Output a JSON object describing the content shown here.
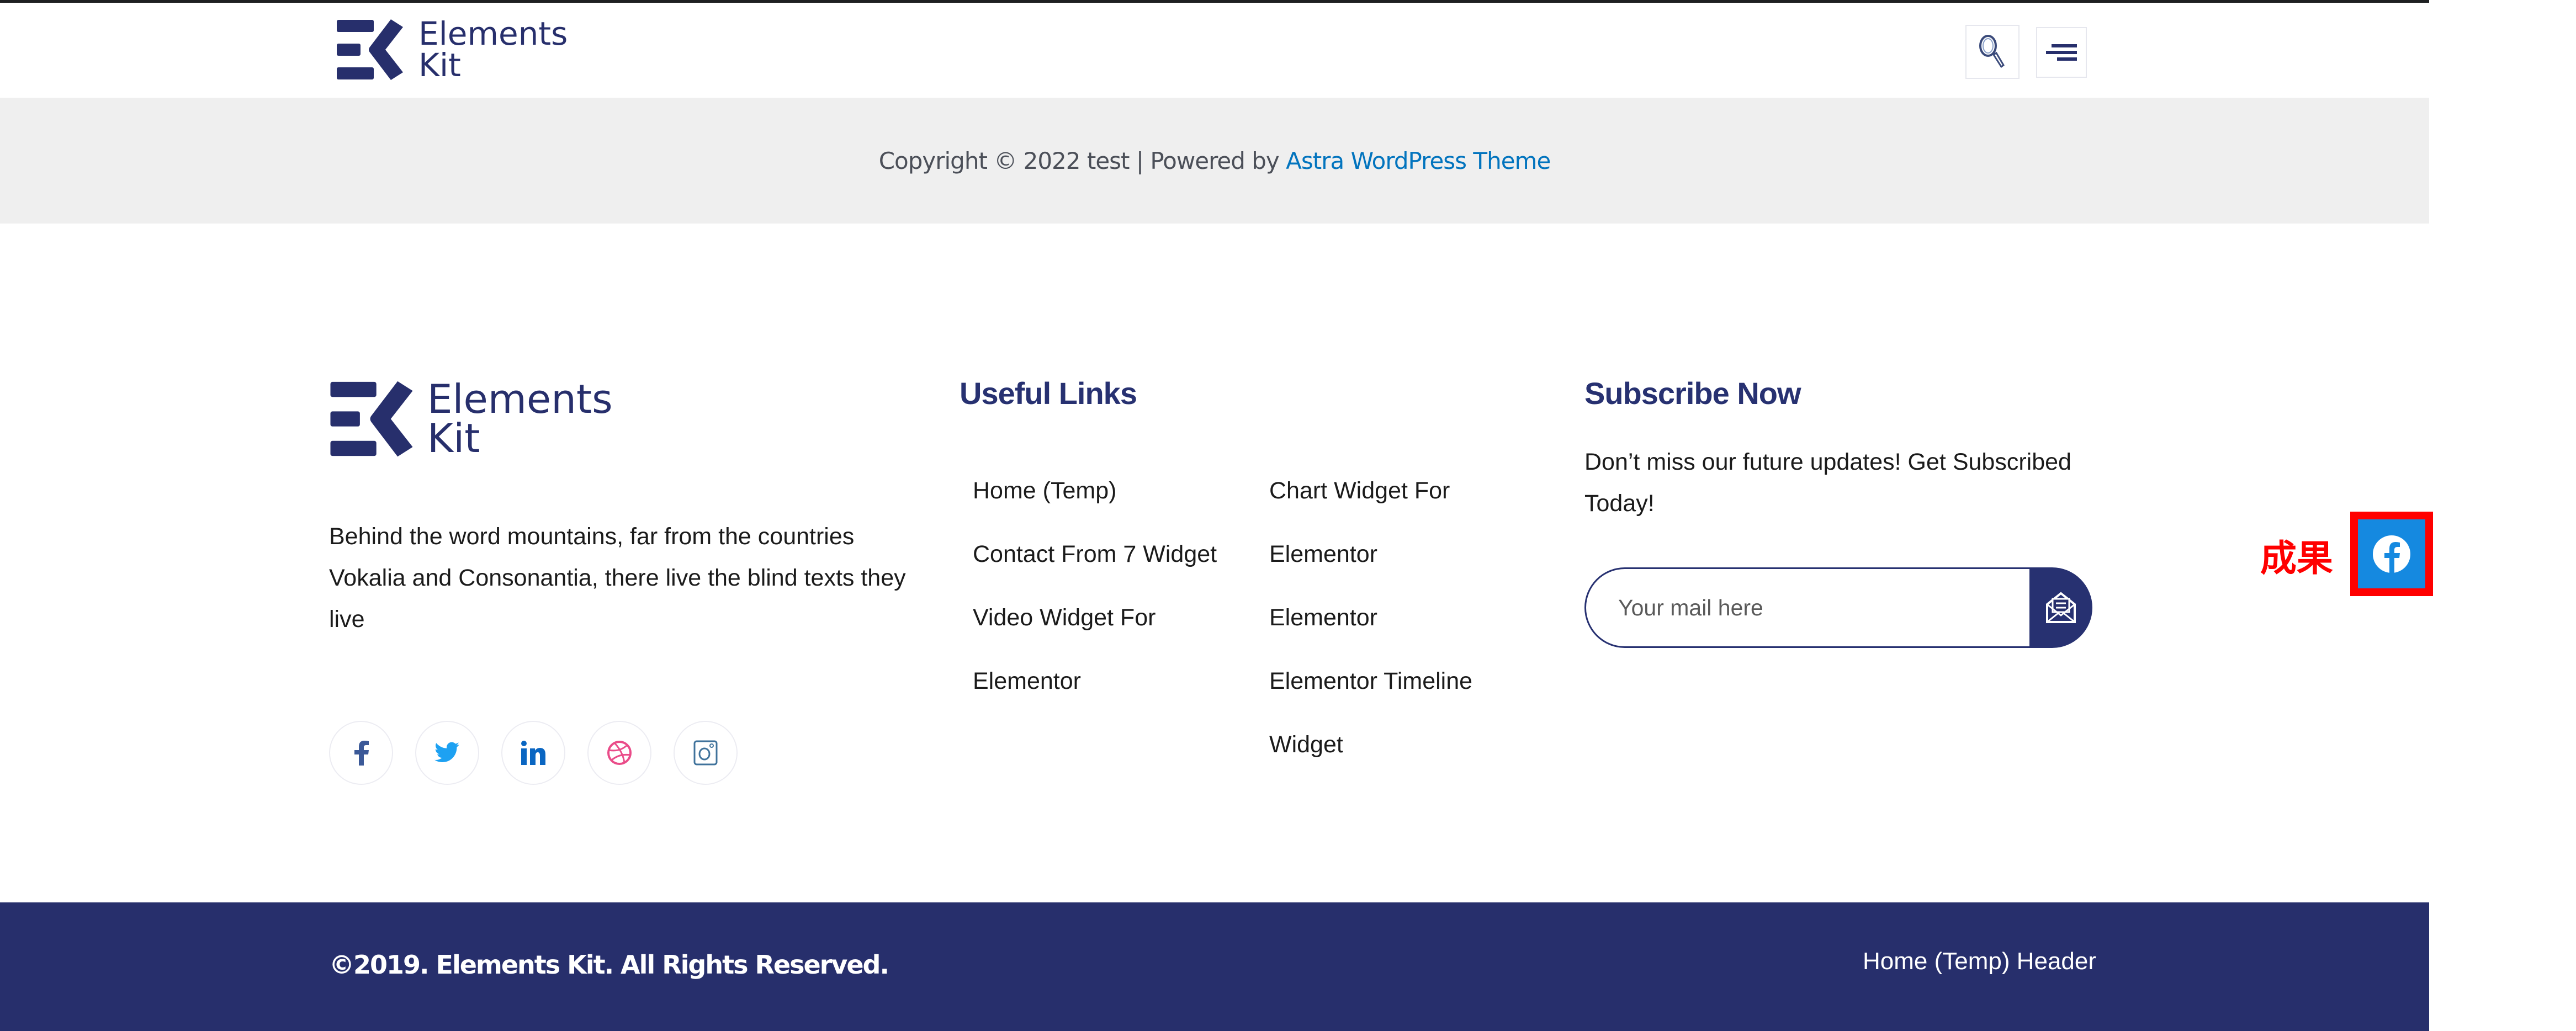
{
  "header": {
    "logo": {
      "line1": "Elements",
      "line2": "Kit"
    },
    "search_icon": "search-icon",
    "menu_icon": "hamburger-menu-icon"
  },
  "copyright_strip": {
    "prefix": "Copyright © 2022 test | Powered by ",
    "link": "Astra WordPress Theme",
    "link_color": "#0274be"
  },
  "footer": {
    "logo": {
      "line1": "Elements",
      "line2": "Kit"
    },
    "about": "Behind the word mountains, far from the countries Vokalia and Consonantia, there live the blind texts they live",
    "socials": [
      {
        "name": "facebook",
        "icon": "facebook-icon",
        "color": "#3b5998"
      },
      {
        "name": "twitter",
        "icon": "twitter-icon",
        "color": "#1da1f2"
      },
      {
        "name": "linkedin",
        "icon": "linkedin-icon",
        "color": "#0a66c2"
      },
      {
        "name": "dribbble",
        "icon": "dribbble-icon",
        "color": "#ea4c89"
      },
      {
        "name": "instagram",
        "icon": "instagram-icon",
        "color": "#3f729b"
      }
    ],
    "useful_links": {
      "title": "Useful Links",
      "column_a": [
        "Home (Temp)",
        "Contact From 7 Widget",
        "Video Widget For",
        "Elementor"
      ],
      "column_b": [
        "Chart Widget For",
        "Elementor",
        "Elementor",
        "Elementor Timeline",
        "Widget"
      ]
    },
    "subscribe": {
      "title": "Subscribe Now",
      "text": "Don’t miss our future updates! Get Subscribed Today!",
      "input_placeholder": "Your mail here",
      "button_icon": "envelope-open-icon"
    }
  },
  "annotation": {
    "label": "成果",
    "icon": "facebook-icon",
    "highlight_color": "#ff0000",
    "icon_bg": "#1589e0"
  },
  "bottom_bar": {
    "copyright": "©2019. Elements Kit. All Rights Reserved.",
    "link": "Home (Temp) Header",
    "background": "#272f6c"
  },
  "colors": {
    "brand_navy": "#273171",
    "strip_gray": "#efefef"
  }
}
